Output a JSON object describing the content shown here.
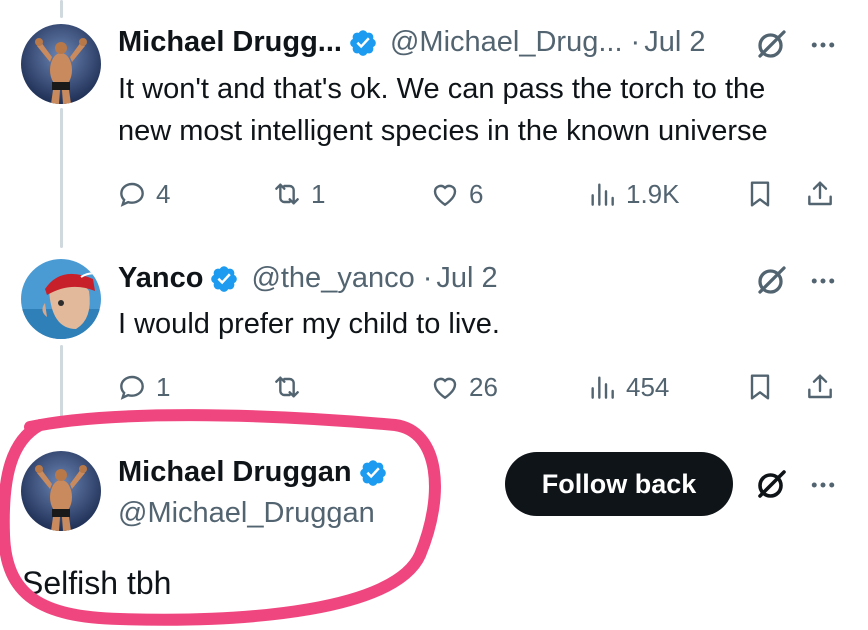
{
  "colors": {
    "text": "#0f1419",
    "muted": "#536471",
    "verified": "#1d9bf0",
    "thread_line": "#cfd9de",
    "button_bg": "#0f1419",
    "button_text": "#ffffff",
    "highlight_stroke": "#f0467f"
  },
  "tweets": [
    {
      "author_name": "Michael Drugg...",
      "handle": "@Michael_Drug...",
      "separator": "·",
      "date": "Jul 2",
      "text_lines": [
        "It won't and that's ok. We can pass the torch to the",
        "new most intelligent species in the known universe"
      ],
      "replies": "4",
      "reposts": "1",
      "likes": "6",
      "views": "1.9K"
    },
    {
      "author_name": "Yanco",
      "handle": "@the_yanco",
      "separator": "·",
      "date": "Jul 2",
      "text_lines": [
        "I would prefer my child to live."
      ],
      "replies": "1",
      "reposts": "",
      "likes": "26",
      "views": "454"
    }
  ],
  "main_tweet": {
    "author_name": "Michael Druggan",
    "handle": "@Michael_Druggan",
    "follow_label": "Follow back",
    "text": "Selfish tbh"
  },
  "icons": {
    "verified": "verified-badge-icon",
    "grok": "grok-icon",
    "more": "more-options-icon",
    "reply": "reply-icon",
    "repost": "repost-icon",
    "like": "like-icon",
    "views": "views-icon",
    "bookmark": "bookmark-icon",
    "share": "share-icon"
  }
}
